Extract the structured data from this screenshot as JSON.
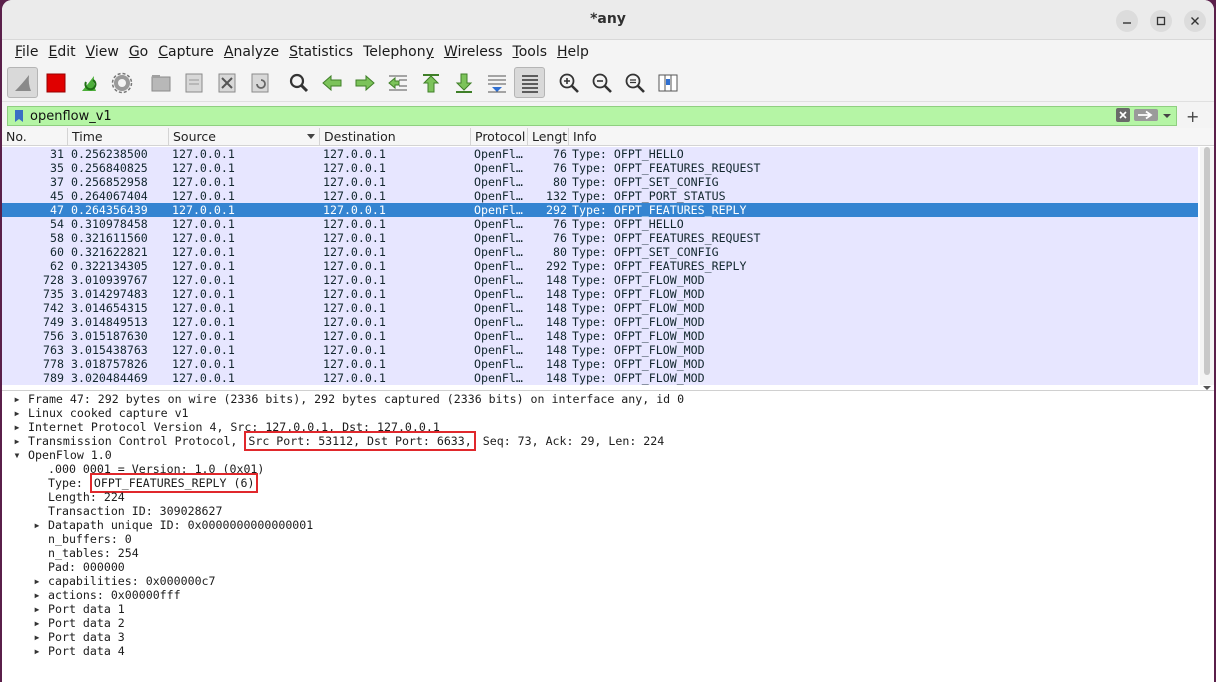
{
  "window": {
    "title": "*any",
    "buttons": [
      "minimize",
      "maximize",
      "close"
    ]
  },
  "menu": [
    {
      "pre": "",
      "u": "F",
      "post": "ile"
    },
    {
      "pre": "",
      "u": "E",
      "post": "dit"
    },
    {
      "pre": "",
      "u": "V",
      "post": "iew"
    },
    {
      "pre": "",
      "u": "G",
      "post": "o"
    },
    {
      "pre": "",
      "u": "C",
      "post": "apture"
    },
    {
      "pre": "",
      "u": "A",
      "post": "nalyze"
    },
    {
      "pre": "",
      "u": "S",
      "post": "tatistics"
    },
    {
      "pre": "Telephon",
      "u": "y",
      "post": ""
    },
    {
      "pre": "",
      "u": "W",
      "post": "ireless"
    },
    {
      "pre": "",
      "u": "T",
      "post": "ools"
    },
    {
      "pre": "",
      "u": "H",
      "post": "elp"
    }
  ],
  "toolbar_icons": [
    "shark-fin-start-icon",
    "stop-capture-icon",
    "restart-capture-icon",
    "capture-options-icon",
    "open-file-icon",
    "save-file-icon",
    "close-file-icon",
    "reload-file-icon",
    "find-packet-icon",
    "go-back-icon",
    "go-forward-icon",
    "go-to-packet-icon",
    "go-first-icon",
    "go-last-icon",
    "autoscroll-icon",
    "colorize-icon",
    "zoom-in-icon",
    "zoom-out-icon",
    "zoom-normal-icon",
    "resize-columns-icon"
  ],
  "filter": {
    "value": "openflow_v1",
    "accent": "#b5f5a5",
    "add_label": "+"
  },
  "columns": [
    "No.",
    "Time",
    "Source",
    "Destination",
    "Protocol",
    "Length",
    "Info"
  ],
  "packets": [
    {
      "no": "31",
      "time": "0.256238500",
      "src": "127.0.0.1",
      "dst": "127.0.0.1",
      "proto": "OpenFl…",
      "len": "76",
      "info": "Type: OFPT_HELLO"
    },
    {
      "no": "35",
      "time": "0.256840825",
      "src": "127.0.0.1",
      "dst": "127.0.0.1",
      "proto": "OpenFl…",
      "len": "76",
      "info": "Type: OFPT_FEATURES_REQUEST"
    },
    {
      "no": "37",
      "time": "0.256852958",
      "src": "127.0.0.1",
      "dst": "127.0.0.1",
      "proto": "OpenFl…",
      "len": "80",
      "info": "Type: OFPT_SET_CONFIG"
    },
    {
      "no": "45",
      "time": "0.264067404",
      "src": "127.0.0.1",
      "dst": "127.0.0.1",
      "proto": "OpenFl…",
      "len": "132",
      "info": "Type: OFPT_PORT_STATUS"
    },
    {
      "no": "47",
      "time": "0.264356439",
      "src": "127.0.0.1",
      "dst": "127.0.0.1",
      "proto": "OpenFl…",
      "len": "292",
      "info": "Type: OFPT_FEATURES_REPLY",
      "selected": true
    },
    {
      "no": "54",
      "time": "0.310978458",
      "src": "127.0.0.1",
      "dst": "127.0.0.1",
      "proto": "OpenFl…",
      "len": "76",
      "info": "Type: OFPT_HELLO"
    },
    {
      "no": "58",
      "time": "0.321611560",
      "src": "127.0.0.1",
      "dst": "127.0.0.1",
      "proto": "OpenFl…",
      "len": "76",
      "info": "Type: OFPT_FEATURES_REQUEST"
    },
    {
      "no": "60",
      "time": "0.321622821",
      "src": "127.0.0.1",
      "dst": "127.0.0.1",
      "proto": "OpenFl…",
      "len": "80",
      "info": "Type: OFPT_SET_CONFIG"
    },
    {
      "no": "62",
      "time": "0.322134305",
      "src": "127.0.0.1",
      "dst": "127.0.0.1",
      "proto": "OpenFl…",
      "len": "292",
      "info": "Type: OFPT_FEATURES_REPLY"
    },
    {
      "no": "728",
      "time": "3.010939767",
      "src": "127.0.0.1",
      "dst": "127.0.0.1",
      "proto": "OpenFl…",
      "len": "148",
      "info": "Type: OFPT_FLOW_MOD"
    },
    {
      "no": "735",
      "time": "3.014297483",
      "src": "127.0.0.1",
      "dst": "127.0.0.1",
      "proto": "OpenFl…",
      "len": "148",
      "info": "Type: OFPT_FLOW_MOD"
    },
    {
      "no": "742",
      "time": "3.014654315",
      "src": "127.0.0.1",
      "dst": "127.0.0.1",
      "proto": "OpenFl…",
      "len": "148",
      "info": "Type: OFPT_FLOW_MOD"
    },
    {
      "no": "749",
      "time": "3.014849513",
      "src": "127.0.0.1",
      "dst": "127.0.0.1",
      "proto": "OpenFl…",
      "len": "148",
      "info": "Type: OFPT_FLOW_MOD"
    },
    {
      "no": "756",
      "time": "3.015187630",
      "src": "127.0.0.1",
      "dst": "127.0.0.1",
      "proto": "OpenFl…",
      "len": "148",
      "info": "Type: OFPT_FLOW_MOD"
    },
    {
      "no": "763",
      "time": "3.015438763",
      "src": "127.0.0.1",
      "dst": "127.0.0.1",
      "proto": "OpenFl…",
      "len": "148",
      "info": "Type: OFPT_FLOW_MOD"
    },
    {
      "no": "778",
      "time": "3.018757826",
      "src": "127.0.0.1",
      "dst": "127.0.0.1",
      "proto": "OpenFl…",
      "len": "148",
      "info": "Type: OFPT_FLOW_MOD"
    },
    {
      "no": "789",
      "time": "3.020484469",
      "src": "127.0.0.1",
      "dst": "127.0.0.1",
      "proto": "OpenFl…",
      "len": "148",
      "info": "Type: OFPT_FLOW_MOD"
    }
  ],
  "details": [
    {
      "level": 0,
      "state": "collapsed",
      "text": "Frame 47: 292 bytes on wire (2336 bits), 292 bytes captured (2336 bits) on interface any, id 0"
    },
    {
      "level": 0,
      "state": "collapsed",
      "text": "Linux cooked capture v1"
    },
    {
      "level": 0,
      "state": "collapsed",
      "text": "Internet Protocol Version 4, Src: 127.0.0.1, Dst: 127.0.0.1"
    },
    {
      "level": 0,
      "state": "collapsed",
      "pre": "Transmission Control Protocol,",
      "hl": "Src Port: 53112, Dst Port: 6633,",
      "post": "Seq: 73, Ack: 29, Len: 224"
    },
    {
      "level": 0,
      "state": "expanded",
      "text": "OpenFlow 1.0"
    },
    {
      "level": 1,
      "state": "none",
      "text": ".000 0001 = Version: 1.0 (0x01)"
    },
    {
      "level": 1,
      "state": "none",
      "pre": "Type:",
      "hl": "OFPT_FEATURES_REPLY (6)",
      "post": ""
    },
    {
      "level": 1,
      "state": "none",
      "text": "Length: 224"
    },
    {
      "level": 1,
      "state": "none",
      "text": "Transaction ID: 309028627"
    },
    {
      "level": 1,
      "state": "collapsed",
      "text": "Datapath unique ID: 0x0000000000000001"
    },
    {
      "level": 1,
      "state": "none",
      "text": "n_buffers: 0"
    },
    {
      "level": 1,
      "state": "none",
      "text": "n_tables: 254"
    },
    {
      "level": 1,
      "state": "none",
      "text": "Pad: 000000"
    },
    {
      "level": 1,
      "state": "collapsed",
      "text": "capabilities: 0x000000c7"
    },
    {
      "level": 1,
      "state": "collapsed",
      "text": "actions: 0x00000fff"
    },
    {
      "level": 1,
      "state": "collapsed",
      "text": "Port data 1"
    },
    {
      "level": 1,
      "state": "collapsed",
      "text": "Port data 2"
    },
    {
      "level": 1,
      "state": "collapsed",
      "text": "Port data 3"
    },
    {
      "level": 1,
      "state": "collapsed",
      "text": "Port data 4"
    }
  ],
  "colors": {
    "row_bg": "#e7e6ff",
    "selected_bg": "#3484d1",
    "highlight_box": "#e0282c"
  }
}
